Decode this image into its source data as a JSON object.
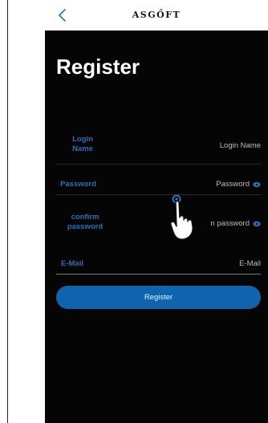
{
  "brand": {
    "logo_text": "ASGŐFT"
  },
  "page": {
    "title": "Register"
  },
  "form": {
    "login_name": {
      "label_line1": "Login",
      "label_line2": "Name",
      "placeholder": "Login Name"
    },
    "password": {
      "label": "Password",
      "placeholder": "Password"
    },
    "confirm_password": {
      "label_line1": "confirm",
      "label_line2": "password",
      "placeholder": "n password"
    },
    "email": {
      "label": "E-Mail",
      "placeholder": "E-Mail"
    },
    "submit_label": "Register"
  },
  "icons": {
    "back": "chevron-left-icon",
    "visibility": "eye-icon",
    "gesture": "tap-hand-icon"
  },
  "colors": {
    "accent": "#0f64ae",
    "label": "#2f6fb8",
    "screen_bg": "#050505"
  }
}
